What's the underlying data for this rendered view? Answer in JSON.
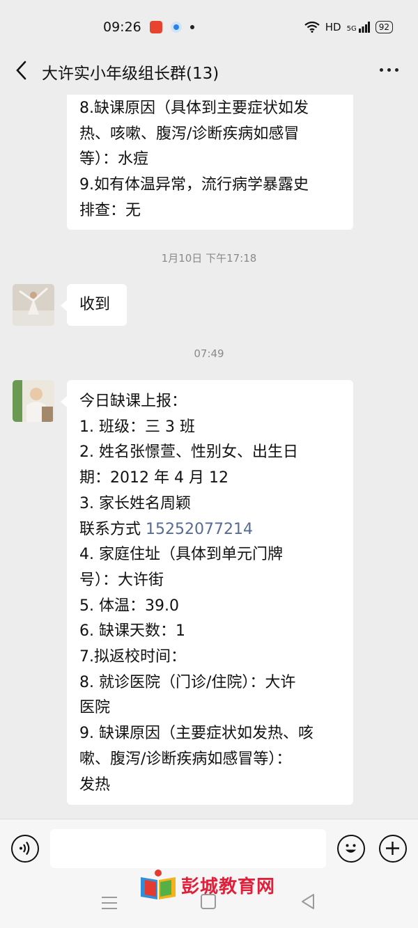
{
  "status_bar": {
    "time": "09:26",
    "network_label": "HD",
    "signal_label": "5G",
    "battery": "92"
  },
  "header": {
    "title": "大许实小年级组长群(13)",
    "back_icon": "chevron-left-icon",
    "more_icon": "more-dots-icon"
  },
  "messages": {
    "first": {
      "lines": [
        "8.缺课原因（具体到主要症状如发",
        "热、咳嗽、腹泻/诊断疾病如感冒",
        "等）：水痘",
        "9.如有体温异常，流行病学暴露史",
        "排查：无"
      ]
    },
    "timestamp1": "1月10日 下午17:18",
    "second": {
      "text": "收到"
    },
    "timestamp2": "07:49",
    "third": {
      "lines": [
        "今日缺课上报：",
        "1. 班级：三 3 班",
        "2. 姓名张憬萱、性别女、出生日",
        "期：2012 年 4 月 12",
        "3. 家长姓名周颖"
      ],
      "contact_label": "联系方式 ",
      "phone": "15252077214",
      "lines_after": [
        "4. 家庭住址（具体到单元门牌",
        "号）：大许街",
        "5. 体温：39.0",
        "6. 缺课天数：1",
        "7.拟返校时间：",
        "8. 就诊医院（门诊/住院）：大许",
        "医院",
        "9. 缺课原因（主要症状如发热、咳",
        "嗽、腹泻/诊断疾病如感冒等）：",
        "发热"
      ]
    }
  },
  "watermark": {
    "text": "彭城教育网"
  },
  "colors": {
    "background": "#ededed",
    "bubble": "#ffffff",
    "link": "#576b95",
    "watermark": "#e0203a"
  }
}
